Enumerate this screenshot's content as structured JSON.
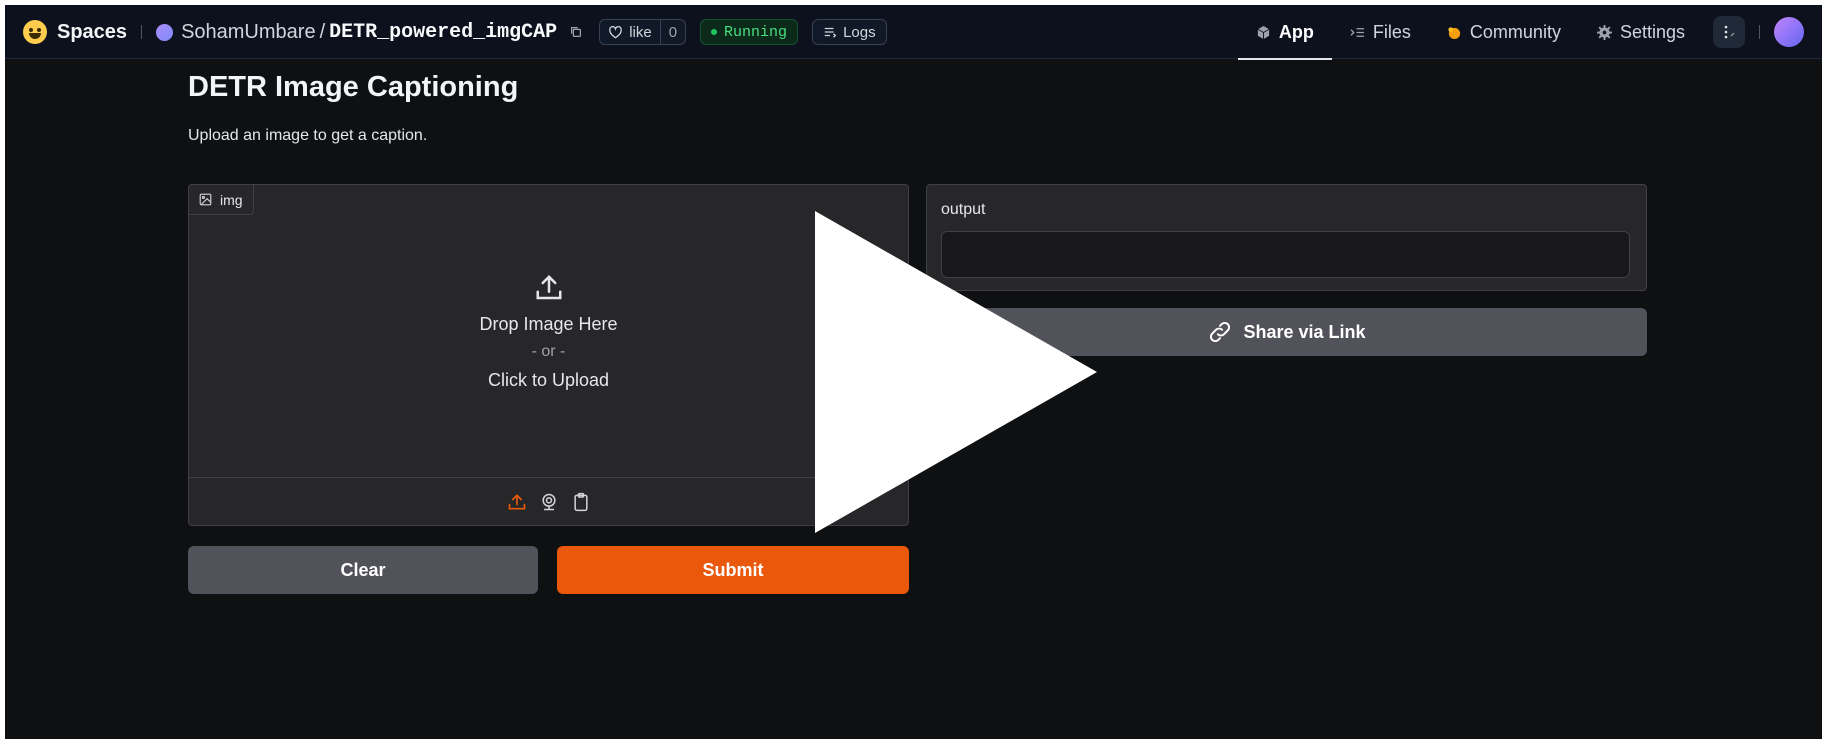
{
  "topbar": {
    "spaces_label": "Spaces",
    "owner": "SohamUmbare",
    "separator": "/",
    "repo": "DETR_powered_imgCAP",
    "like_label": "like",
    "like_count": "0",
    "status": "Running",
    "logs_label": "Logs",
    "tabs": [
      {
        "label": "App",
        "icon": "cube-icon",
        "active": true
      },
      {
        "label": "Files",
        "icon": "files-icon",
        "active": false
      },
      {
        "label": "Community",
        "icon": "community-icon",
        "active": false
      },
      {
        "label": "Settings",
        "icon": "gear-icon",
        "active": false
      }
    ]
  },
  "main": {
    "title": "DETR Image Captioning",
    "description": "Upload an image to get a caption.",
    "image_input": {
      "label": "img",
      "drop_text": "Drop Image Here",
      "or_text": "- or -",
      "click_text": "Click to Upload",
      "sources": [
        "upload-icon",
        "webcam-icon",
        "clipboard-icon"
      ]
    },
    "clear_label": "Clear",
    "submit_label": "Submit",
    "output": {
      "label": "output",
      "value": ""
    },
    "share_label": "Share via Link"
  },
  "colors": {
    "background": "#0f1012",
    "panel": "#27272a",
    "accent": "#ea580c",
    "secondary_button": "#52525b",
    "running": "#22c55e"
  }
}
